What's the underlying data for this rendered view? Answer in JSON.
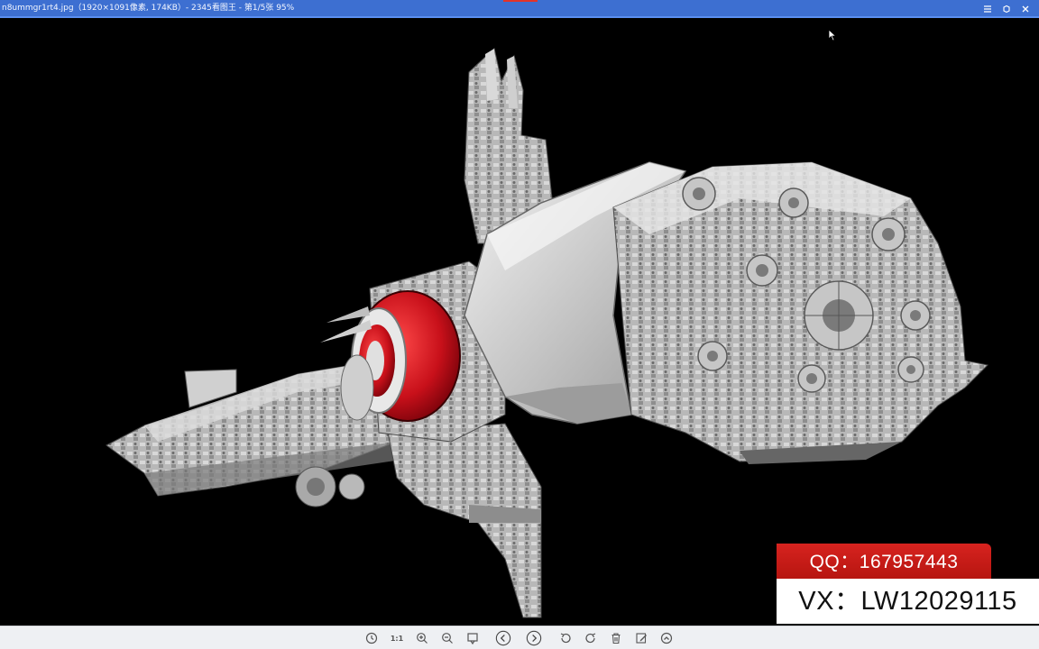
{
  "window": {
    "title": "n8ummgr1rt4.jpg（1920×1091像素, 174KB）- 2345看图王 - 第1/5张 95%",
    "controls": [
      "menu-icon",
      "skin-icon",
      "close-icon"
    ],
    "accent_color": "#3d6fd1"
  },
  "watermark": {
    "qq": "QQ：167957443",
    "vx": "VX：LW12029115",
    "qq_color": "#c91b17"
  },
  "toolbar": {
    "actual_size_label": "1:1",
    "buttons": [
      "clock-icon",
      "actual-size-icon",
      "zoom-in-icon",
      "zoom-out-icon",
      "bookmark-icon",
      "prev-icon",
      "next-icon",
      "rotate-left-icon",
      "rotate-right-icon",
      "delete-icon",
      "edit-icon",
      "up-icon"
    ]
  }
}
